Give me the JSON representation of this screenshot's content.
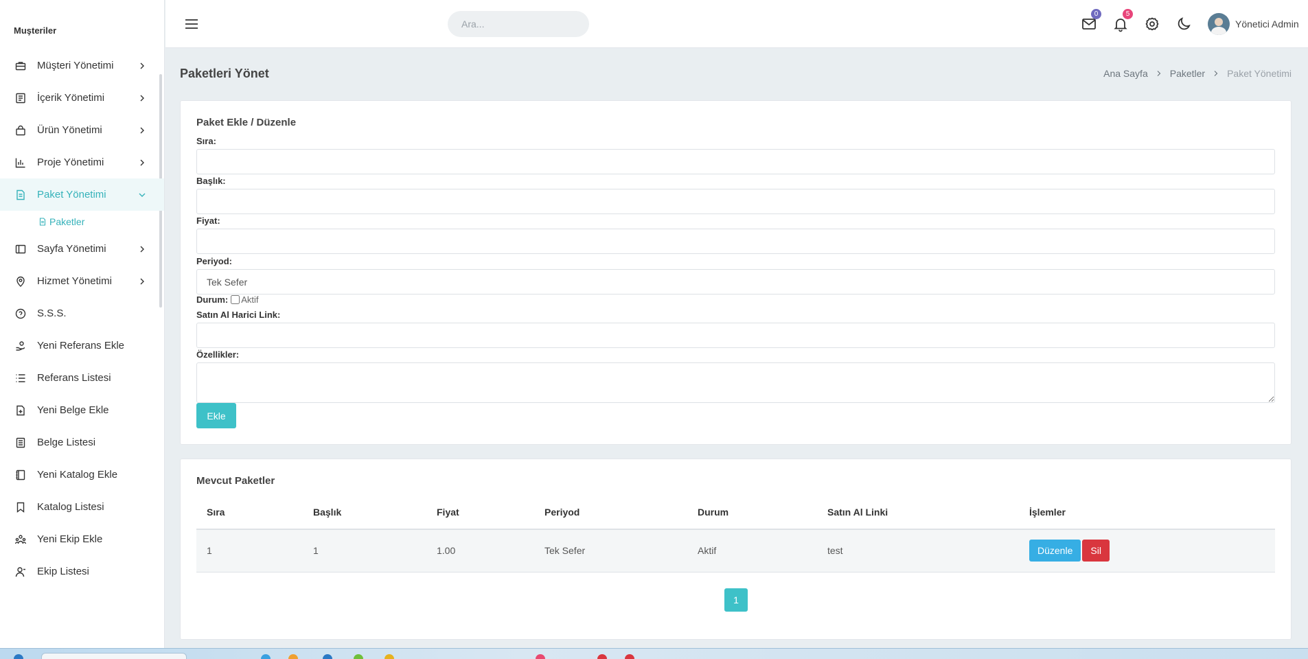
{
  "sidebar": {
    "section_title": "Muşteriler",
    "items": [
      {
        "label": "Müşteri Yönetimi",
        "icon": "briefcase-icon",
        "chevron": true
      },
      {
        "label": "İçerik Yönetimi",
        "icon": "document-list-icon",
        "chevron": true
      },
      {
        "label": "Ürün Yönetimi",
        "icon": "shopping-bag-icon",
        "chevron": true
      },
      {
        "label": "Proje Yönetimi",
        "icon": "bar-chart-icon",
        "chevron": true
      },
      {
        "label": "Paket Yönetimi",
        "icon": "file-icon",
        "chevron": true,
        "active": true
      },
      {
        "label": "Sayfa Yönetimi",
        "icon": "layout-icon",
        "chevron": true
      },
      {
        "label": "Hizmet Yönetimi",
        "icon": "map-pin-icon",
        "chevron": true
      },
      {
        "label": "S.S.S.",
        "icon": "help-circle-icon",
        "chevron": false
      },
      {
        "label": "Yeni Referans Ekle",
        "icon": "hand-coin-icon",
        "chevron": false
      },
      {
        "label": "Referans Listesi",
        "icon": "list-icon",
        "chevron": false
      },
      {
        "label": "Yeni Belge Ekle",
        "icon": "file-plus-icon",
        "chevron": false
      },
      {
        "label": "Belge Listesi",
        "icon": "file-text-icon",
        "chevron": false
      },
      {
        "label": "Yeni Katalog Ekle",
        "icon": "book-icon",
        "chevron": false
      },
      {
        "label": "Katalog Listesi",
        "icon": "bookmark-icon",
        "chevron": false
      },
      {
        "label": "Yeni Ekip Ekle",
        "icon": "team-icon",
        "chevron": false
      },
      {
        "label": "Ekip Listesi",
        "icon": "user-icon",
        "chevron": false
      }
    ],
    "submenu": {
      "label": "Paketler"
    }
  },
  "topbar": {
    "search_placeholder": "Ara...",
    "mail_badge": "0",
    "notification_badge": "5",
    "user_name": "Yönetici Admin"
  },
  "page": {
    "title": "Paketleri Yönet",
    "breadcrumb": [
      "Ana Sayfa",
      "Paketler",
      "Paket Yönetimi"
    ]
  },
  "form": {
    "title": "Paket Ekle / Düzenle",
    "order_label": "Sıra:",
    "title_label": "Başlık:",
    "price_label": "Fiyat:",
    "period_label": "Periyod:",
    "period_value": "Tek Sefer",
    "status_label": "Durum:",
    "status_checkbox_label": "Aktif",
    "link_label": "Satın Al Harici Link:",
    "features_label": "Özellikler:",
    "submit_label": "Ekle"
  },
  "table": {
    "title": "Mevcut Paketler",
    "headers": [
      "Sıra",
      "Başlık",
      "Fiyat",
      "Periyod",
      "Durum",
      "Satın Al Linki",
      "İşlemler"
    ],
    "rows": [
      {
        "order": "1",
        "title": "1",
        "price": "1.00",
        "period": "Tek Sefer",
        "status": "Aktif",
        "link": "test",
        "edit_label": "Düzenle",
        "delete_label": "Sil"
      }
    ],
    "pagination": [
      "1"
    ]
  },
  "colors": {
    "accent": "#3ec1c8",
    "edit": "#36aee4",
    "delete": "#d9363e",
    "mail_badge": "#6f6abf",
    "notification_badge": "#e8457a"
  }
}
